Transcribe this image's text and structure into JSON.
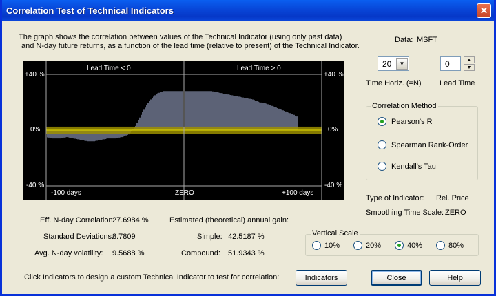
{
  "window": {
    "title": "Correlation Test of Technical Indicators"
  },
  "description": {
    "line1": "The graph shows the correlation between values of the Technical Indicator (using only past data)",
    "line2": "and N-day future returns, as a function of the lead time (relative to present) of the Technical Indicator."
  },
  "chart_labels": {
    "lead_neg": "Lead Time < 0",
    "lead_pos": "Lead Time > 0",
    "y_top": "+40 %",
    "y_mid": "0%",
    "y_bottom": "-40 %",
    "x_left": "-100 days",
    "x_mid": "ZERO",
    "x_right": "+100 days"
  },
  "chart_data": {
    "type": "bar",
    "x": [
      -100,
      -95,
      -90,
      -85,
      -80,
      -75,
      -70,
      -65,
      -60,
      -55,
      -50,
      -45,
      -40,
      -35,
      -30,
      -25,
      -20,
      -15,
      -10,
      -5,
      0,
      5,
      10,
      15,
      20,
      25,
      30,
      35,
      40,
      45,
      50,
      55,
      60,
      65,
      70,
      75,
      80,
      85,
      90,
      95,
      100
    ],
    "values": [
      -5,
      -6,
      -6,
      -5,
      -6,
      -7,
      -8,
      -8,
      -7,
      -6,
      -6,
      -5,
      -3,
      3,
      13,
      21,
      26,
      28,
      28,
      28,
      28,
      28,
      28,
      28,
      28,
      27,
      26,
      25,
      24,
      23,
      22,
      20,
      19,
      17,
      15,
      13,
      11,
      8,
      5,
      3,
      0
    ],
    "ylim": [
      -40,
      40
    ],
    "band": 2.5,
    "colors": {
      "bars": "#B8C4EC",
      "band": "#9C8F00",
      "background": "#000000",
      "grid": "#AAAAAA"
    }
  },
  "data_field": {
    "label": "Data:",
    "value": "MSFT"
  },
  "time_horiz": {
    "value": "20",
    "label": "Time Horiz. (=N)"
  },
  "lead_time": {
    "value": "0",
    "label": "Lead Time"
  },
  "correlation_method": {
    "title": "Correlation Method",
    "options": [
      "Pearson's R",
      "Spearman Rank-Order",
      "Kendall's Tau"
    ],
    "selected": "Pearson's R"
  },
  "indicator_info": {
    "type_label": "Type of Indicator:",
    "type_value": "Rel. Price",
    "smoothing_label": "Smoothing Time Scale:",
    "smoothing_value": "ZERO"
  },
  "stats": {
    "eff_label": "Eff. N-day Correlation:",
    "eff_value": "27.6984 %",
    "std_label": "Standard Deviations:",
    "std_value": "8.7809",
    "vol_label": "Avg. N-day volatility:",
    "vol_value": "9.5688 %",
    "gain_title": "Estimated (theoretical) annual gain:",
    "simple_label": "Simple:",
    "simple_value": "42.5187 %",
    "compound_label": "Compound:",
    "compound_value": "51.9343 %"
  },
  "vertical_scale": {
    "title": "Vertical Scale",
    "options": [
      "10%",
      "20%",
      "40%",
      "80%"
    ],
    "selected": "40%"
  },
  "footer": {
    "hint": "Click Indicators to design a custom Technical Indicator to test for correlation:",
    "indicators_button": "Indicators",
    "close_button": "Close",
    "help_button": "Help"
  }
}
